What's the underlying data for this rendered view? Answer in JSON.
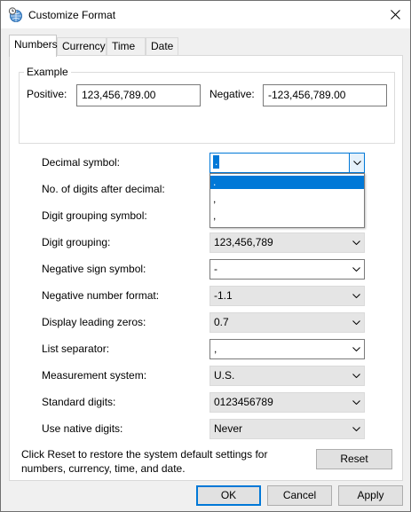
{
  "window": {
    "title": "Customize Format",
    "icon": "globe-clock-icon",
    "close_icon": "close-icon"
  },
  "tabs": [
    {
      "label": "Numbers",
      "active": true
    },
    {
      "label": "Currency",
      "active": false
    },
    {
      "label": "Time",
      "active": false
    },
    {
      "label": "Date",
      "active": false
    }
  ],
  "example": {
    "group_label": "Example",
    "positive_label": "Positive:",
    "positive_value": "123,456,789.00",
    "negative_label": "Negative:",
    "negative_value": "-123,456,789.00"
  },
  "settings": [
    {
      "label": "Decimal symbol:",
      "value": ".",
      "kind": "editable-combo",
      "open": true
    },
    {
      "label": "No. of digits after decimal:",
      "value": "",
      "kind": "list-combo"
    },
    {
      "label": "Digit grouping symbol:",
      "value": "",
      "kind": "editable-combo"
    },
    {
      "label": "Digit grouping:",
      "value": "123,456,789",
      "kind": "list-combo"
    },
    {
      "label": "Negative sign symbol:",
      "value": "-",
      "kind": "editable-combo"
    },
    {
      "label": "Negative number format:",
      "value": "-1.1",
      "kind": "list-combo"
    },
    {
      "label": "Display leading zeros:",
      "value": "0.7",
      "kind": "list-combo"
    },
    {
      "label": "List separator:",
      "value": ",",
      "kind": "editable-combo"
    },
    {
      "label": "Measurement system:",
      "value": "U.S.",
      "kind": "list-combo"
    },
    {
      "label": "Standard digits:",
      "value": "0123456789",
      "kind": "list-combo"
    },
    {
      "label": "Use native digits:",
      "value": "Never",
      "kind": "list-combo"
    }
  ],
  "decimal_dropdown": {
    "options": [
      ".",
      ",",
      ","
    ],
    "selected_index": 0
  },
  "footer": {
    "reset_note": "Click Reset to restore the system default settings for numbers, currency, time, and date.",
    "reset_label": "Reset"
  },
  "buttons": {
    "ok": "OK",
    "cancel": "Cancel",
    "apply": "Apply"
  },
  "colors": {
    "accent": "#0078d7",
    "dialog_background": "#f0f0f0",
    "panel_background": "#ffffff"
  }
}
